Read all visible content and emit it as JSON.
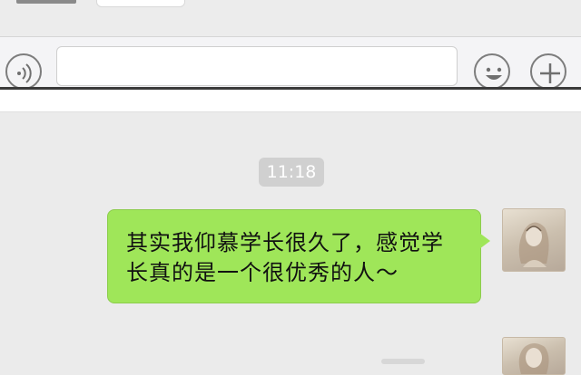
{
  "input_bar": {
    "text_value": "",
    "voice_icon": "voice-icon",
    "emoji_icon": "emoji-icon",
    "plus_icon": "plus-icon"
  },
  "chat": {
    "timestamp": "11:18",
    "messages": [
      {
        "text": "其实我仰慕学长很久了，感觉学长真的是一个很优秀的人～",
        "side": "right",
        "bubble_color": "#9fe659"
      }
    ]
  },
  "colors": {
    "background": "#ebebeb",
    "bubble_green": "#9fe659",
    "timestamp_bg": "#d0d0d0"
  }
}
